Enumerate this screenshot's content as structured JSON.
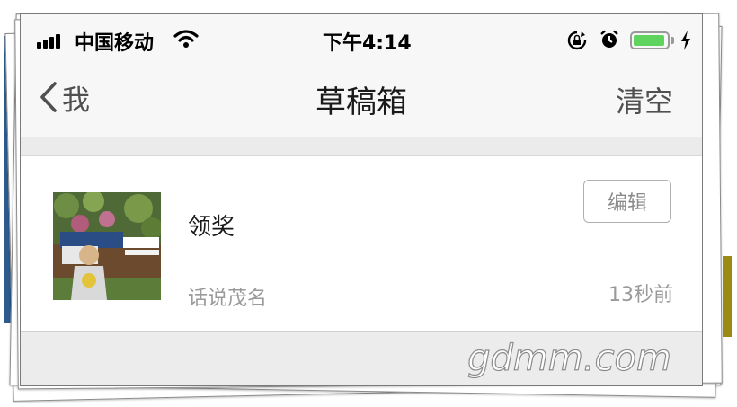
{
  "status_bar": {
    "carrier": "中国移动",
    "time": "下午4:14",
    "battery_level": 0.9,
    "icons": [
      "signal-icon",
      "wifi-icon",
      "orientation-lock-icon",
      "alarm-icon",
      "battery-icon",
      "charging-bolt-icon"
    ]
  },
  "nav": {
    "back_label": "我",
    "title": "草稿箱",
    "clear_label": "清空"
  },
  "drafts": [
    {
      "title": "领奖",
      "subtitle": "话说茂名",
      "edit_label": "编辑",
      "time": "13秒前"
    }
  ],
  "watermark": {
    "text": "gdmm.com"
  },
  "colors": {
    "battery_green": "#5ed35e",
    "nav_text": "#505050",
    "muted_text": "#9a9a9a"
  }
}
